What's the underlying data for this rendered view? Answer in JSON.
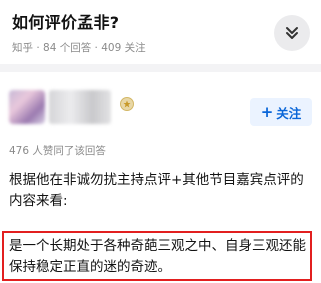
{
  "question": {
    "title": "如何评价孟非?",
    "meta": "知乎 · 84 个回答 · 409 关注"
  },
  "answer": {
    "follow_label": "关注",
    "follow_plus": "+",
    "likes_text": "476 人赞同了该回答",
    "paragraph1": "根据他在非诚勿扰主持点评+其他节目嘉宾点评的内容来看:",
    "paragraph2": "是一个长期处于各种奇葩三观之中、自身三观还能保持稳定正直的迷的奇迹。"
  },
  "icons": {
    "collapse": "chevron-double-down-icon",
    "badge": "certification-badge-icon"
  },
  "colors": {
    "accent": "#0a66d8",
    "follow_bg": "#ebf3ff",
    "highlight_border": "#e21f1f",
    "muted_text": "#8a8a8a"
  }
}
